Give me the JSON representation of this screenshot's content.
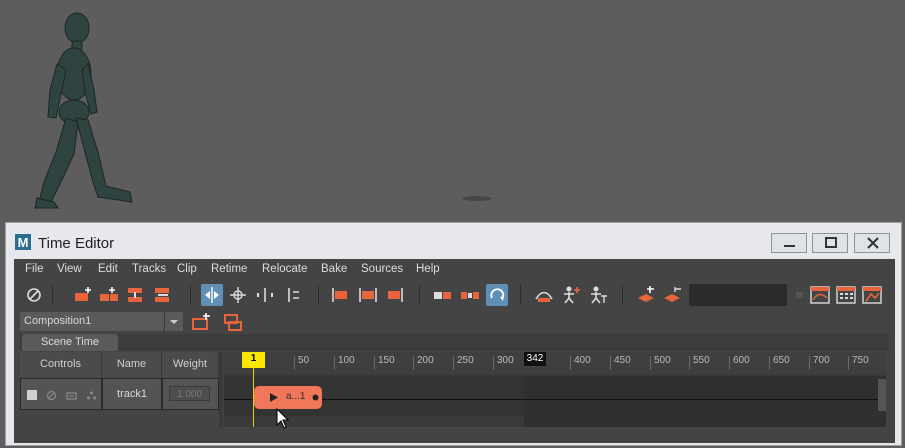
{
  "window": {
    "title": "Time Editor",
    "app_icon_letter": "M"
  },
  "menu": [
    "File",
    "View",
    "Edit",
    "Tracks",
    "Clip",
    "Retime",
    "Relocate",
    "Bake",
    "Sources",
    "Help"
  ],
  "toolbar_icons": [
    "mute-solo-toggle-icon",
    "create-track-icon",
    "create-track-from-selection-icon",
    "merge-tracks-icon",
    "split-tracks-icon",
    "ripple-edit-icon",
    "move-keys-icon",
    "split-clip-icon",
    "trim-clip-icon",
    "trim-start-icon",
    "trim-end-icon",
    "hold-clip-icon",
    "group-clips-icon",
    "loop-icon",
    "crossfade-icon",
    "character-add-icon",
    "character-remove-icon",
    "add-layer-icon",
    "remove-layer-icon",
    "graph-editor-icon",
    "dope-sheet-icon",
    "bake-icon"
  ],
  "composition": {
    "selected": "Composition1"
  },
  "tabs": [
    "Scene Time"
  ],
  "columns": {
    "controls": "Controls",
    "name": "Name",
    "weight": "Weight"
  },
  "tracks": [
    {
      "name": "track1",
      "weight": "1.000"
    }
  ],
  "ruler": {
    "labels": [
      "50",
      "100",
      "150",
      "200",
      "250",
      "300",
      "400",
      "450",
      "500",
      "550",
      "600",
      "650",
      "700",
      "750"
    ]
  },
  "playhead": {
    "frame": "1"
  },
  "end_marker": {
    "frame": "342"
  },
  "clip": {
    "label": "a...1"
  },
  "colors": {
    "clip": "#f0775a",
    "playhead": "#ffe600",
    "active_tool": "#5f8fb5",
    "accent_icon": "#e8643c"
  }
}
